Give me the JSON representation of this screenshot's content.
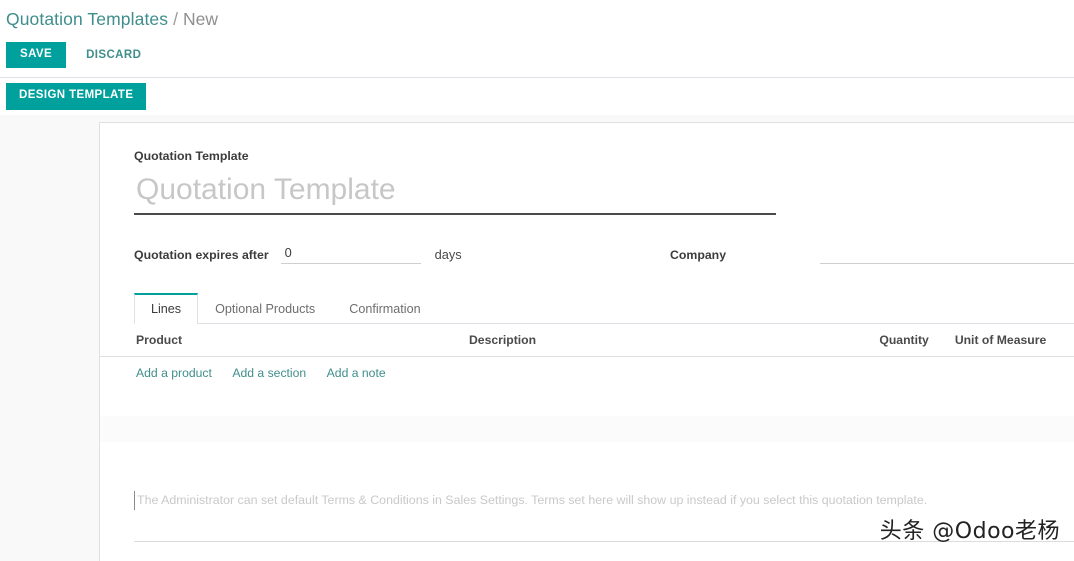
{
  "breadcrumb": {
    "root": "Quotation Templates",
    "separator": "/",
    "current": "New"
  },
  "actions": {
    "save_label": "SAVE",
    "discard_label": "DISCARD"
  },
  "statusbar": {
    "design_template_label": "DESIGN TEMPLATE"
  },
  "form": {
    "title_label": "Quotation Template",
    "title_value": "",
    "title_placeholder": "Quotation Template",
    "expiry_label": "Quotation expires after",
    "expiry_value": "0",
    "days_suffix": "days",
    "company_label": "Company",
    "company_value": ""
  },
  "notebook": {
    "tabs": [
      {
        "label": "Lines",
        "active": true
      },
      {
        "label": "Optional Products",
        "active": false
      },
      {
        "label": "Confirmation",
        "active": false
      }
    ]
  },
  "lines_table": {
    "columns": [
      "Product",
      "Description",
      "Quantity",
      "Unit of Measure"
    ],
    "rows": [],
    "add_links": [
      "Add a product",
      "Add a section",
      "Add a note"
    ]
  },
  "terms": {
    "placeholder": "The Administrator can set default Terms & Conditions in Sales Settings. Terms set here will show up instead if you select this quotation template.",
    "value": ""
  },
  "watermark": {
    "text": "头条 @Odoo老杨"
  },
  "colors": {
    "accent": "#00a09d",
    "link": "#3f8e8c",
    "text": "#3c3c3c",
    "muted": "#8f8f8f",
    "border": "#dee2e6",
    "page_bg": "#f9f9f9"
  }
}
